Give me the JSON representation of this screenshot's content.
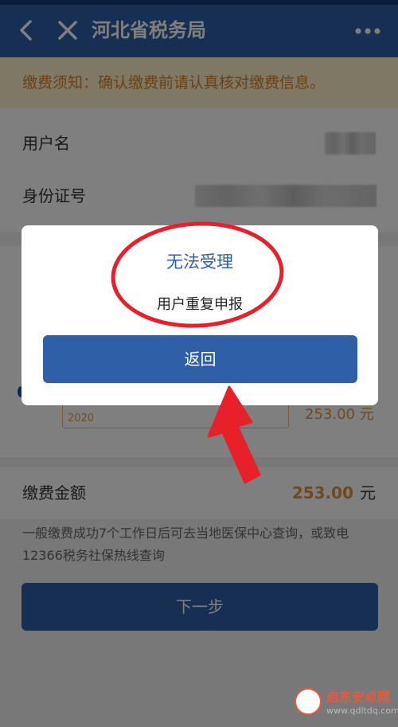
{
  "header": {
    "title": "河北省税务局",
    "icons": [
      "back-arrow-icon",
      "close-icon",
      "more-icon"
    ]
  },
  "notice": {
    "text": "缴费须知：确认缴费前请认真核对缴费信息。"
  },
  "info": {
    "username_label": "用户名",
    "idcard_label": "身份证号"
  },
  "package": {
    "year": "2020",
    "price": "253.00 元"
  },
  "amount": {
    "label": "缴费金额",
    "value": "253.00",
    "unit": "元"
  },
  "hint": "一般缴费成功7个工作日后可去当地医保中心查询，或致电12366税务社保热线查询",
  "next_button": "下一步",
  "dialog": {
    "title": "无法受理",
    "message": "用户重复申报",
    "button": "返回"
  },
  "watermark": {
    "name": "启东安卓网",
    "url": "www.qdltdq.com"
  },
  "colors": {
    "primary": "#2f5fa6",
    "accent": "#e5913c",
    "annotation": "#e8202a"
  }
}
